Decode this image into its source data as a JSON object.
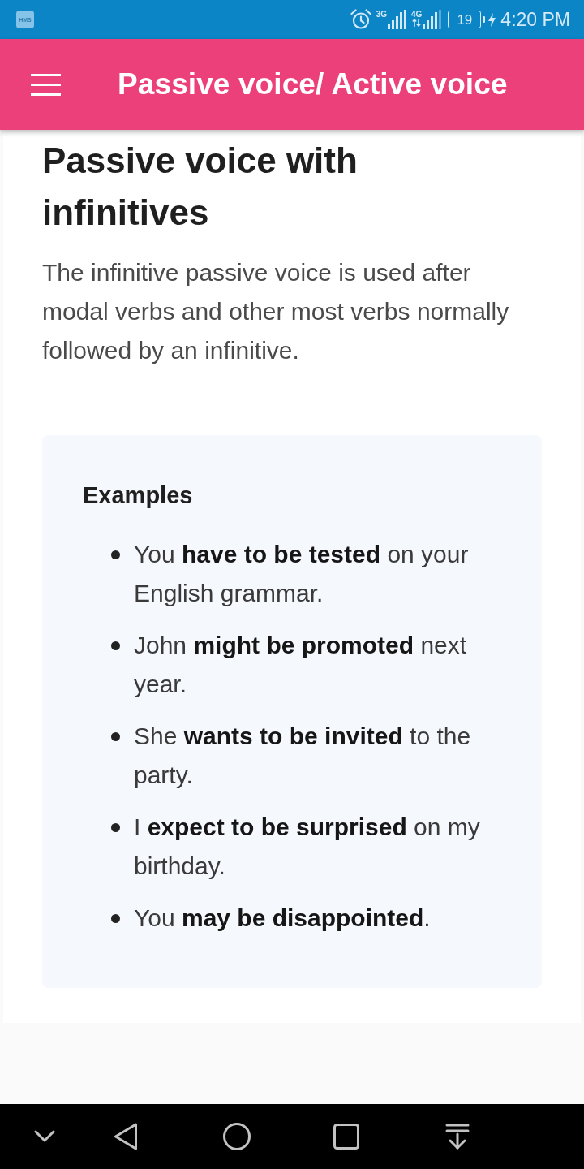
{
  "status_bar": {
    "app_icon": "HMS",
    "networks": [
      {
        "type": "3G"
      },
      {
        "type": "4G"
      }
    ],
    "battery": "19",
    "time": "4:20 PM"
  },
  "app_bar": {
    "title": "Passive voice/ Active voice"
  },
  "article": {
    "heading": "Passive voice with infinitives",
    "intro": "The infinitive passive voice is used after modal verbs and other most verbs normally followed by an infinitive.",
    "examples": {
      "title": "Examples",
      "items": [
        "You **have to be tested** on your English grammar.",
        "John **might be promoted** next year.",
        "She **wants to be invited** to the party.",
        "I **expect to be surprised** on my birthday.",
        "You **may be disappointed**."
      ]
    }
  }
}
